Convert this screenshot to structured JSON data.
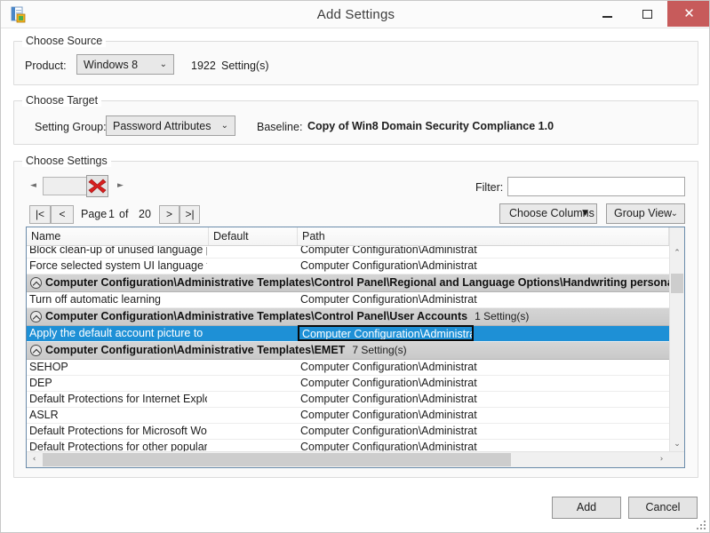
{
  "window": {
    "title": "Add Settings",
    "icon": "add-settings-icon",
    "minimize_label": "Minimize",
    "maximize_label": "Maximize",
    "close_label": "✕"
  },
  "source_group": {
    "title": "Choose Source",
    "product_label": "Product:",
    "product_value": "Windows 8",
    "chevron": "⌄",
    "count": "1922",
    "count_unit": "Setting(s)"
  },
  "target_group": {
    "title": "Choose Target",
    "setting_group_label": "Setting Group:",
    "setting_group_value": "Password Attributes",
    "chevron": "⌄",
    "baseline_label": "Baseline:",
    "baseline_value": "Copy of Win8 Domain Security Compliance 1.0"
  },
  "settings_group": {
    "title": "Choose Settings",
    "toolbar": {
      "combo_value": "",
      "chevron": "⌄",
      "left_arrow": "◄",
      "right_arrow": "►",
      "delete_label": "Delete"
    },
    "pager": {
      "first_label": "|<",
      "prev_label": "<",
      "page_word": "Page",
      "page_number": "1",
      "of_word": "of",
      "total_pages": "20",
      "next_label": ">",
      "last_label": ">|"
    },
    "filter": {
      "label": "Filter:",
      "value": "",
      "placeholder": ""
    },
    "choose_columns_label": "Choose Columns",
    "choose_columns_caret": "▼",
    "group_view_label": "Group View",
    "group_view_chevron": "⌄"
  },
  "grid": {
    "columns": [
      "Name",
      "Default",
      "Path"
    ],
    "rows": [
      {
        "kind": "row",
        "clipped": true,
        "name": "Block clean-up of unused language p",
        "default": "",
        "path": "Computer Configuration\\Administrat"
      },
      {
        "kind": "row",
        "name": "Force selected system UI language to",
        "default": "",
        "path": "Computer Configuration\\Administrat"
      },
      {
        "kind": "group",
        "title": "Computer Configuration\\Administrative Templates\\Control Panel\\Regional and Language Options\\Handwriting personaliza",
        "count": ""
      },
      {
        "kind": "row",
        "name": "Turn off automatic learning",
        "default": "",
        "path": "Computer Configuration\\Administrat"
      },
      {
        "kind": "group",
        "title": "Computer Configuration\\Administrative Templates\\Control Panel\\User Accounts",
        "count": "1 Setting(s)"
      },
      {
        "kind": "row",
        "selected": true,
        "name": "Apply the default account picture to",
        "default": "",
        "path": "Computer Configuration\\Administrat"
      },
      {
        "kind": "group",
        "title": "Computer Configuration\\Administrative Templates\\EMET",
        "count": "7 Setting(s)"
      },
      {
        "kind": "row",
        "name": "SEHOP",
        "default": "",
        "path": "Computer Configuration\\Administrat"
      },
      {
        "kind": "row",
        "name": "DEP",
        "default": "",
        "path": "Computer Configuration\\Administrat"
      },
      {
        "kind": "row",
        "name": "Default Protections for Internet Explo",
        "default": "",
        "path": "Computer Configuration\\Administrat"
      },
      {
        "kind": "row",
        "name": "ASLR",
        "default": "",
        "path": "Computer Configuration\\Administrat"
      },
      {
        "kind": "row",
        "name": "Default Protections for Microsoft Wo",
        "default": "",
        "path": "Computer Configuration\\Administrat"
      },
      {
        "kind": "row",
        "clipped_bottom": true,
        "name": "Default Protections for other popular",
        "default": "",
        "path": "Computer Configuration\\Administrat"
      }
    ],
    "scroll": {
      "up_arrow": "⌃",
      "down_arrow": "⌄",
      "left_arrow": "‹",
      "right_arrow": "›"
    }
  },
  "footer": {
    "add_label": "Add",
    "cancel_label": "Cancel"
  },
  "colors": {
    "selection": "#1e90d6",
    "close_button": "#c75b5b",
    "group_header": "#cdcdcd",
    "grid_border": "#6a8baa"
  }
}
